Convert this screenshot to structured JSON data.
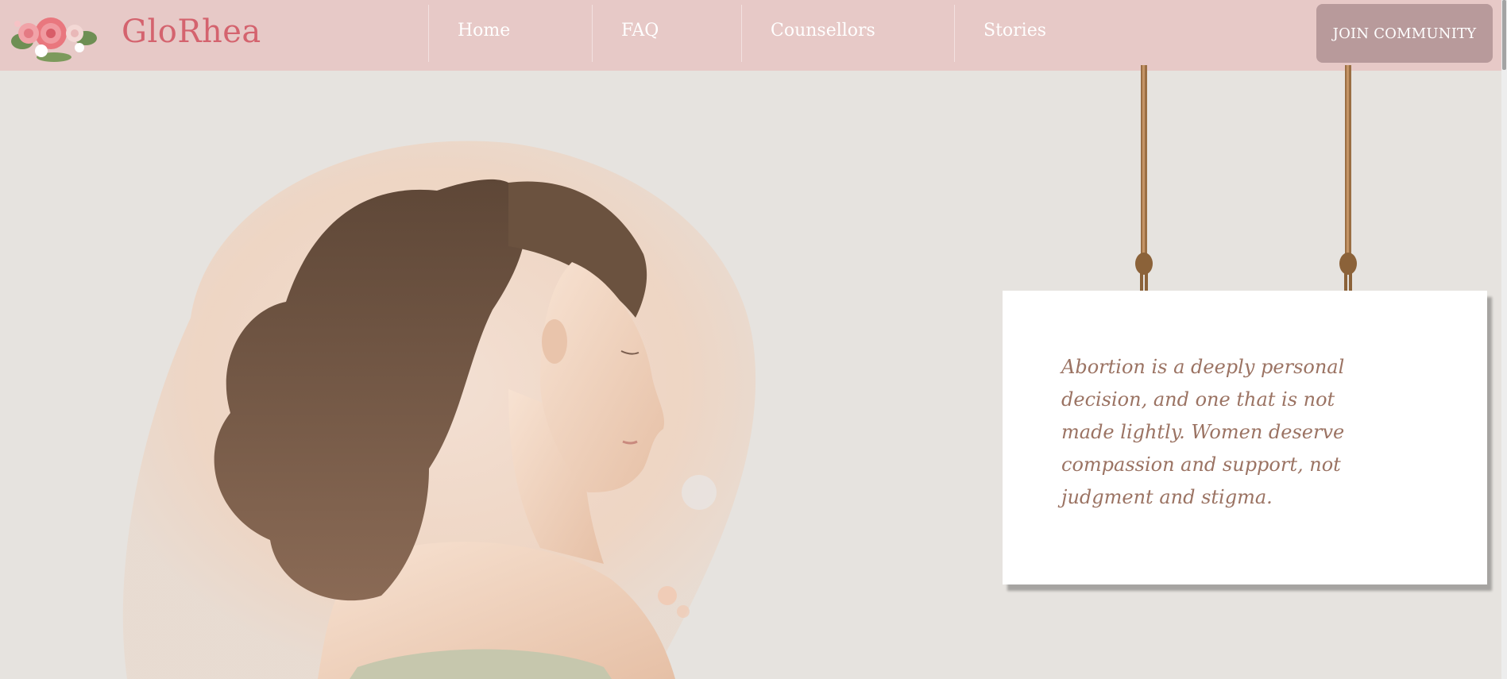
{
  "header": {
    "brand": "GloRhea",
    "nav": [
      {
        "label": "Home"
      },
      {
        "label": "FAQ"
      },
      {
        "label": "Counsellors"
      },
      {
        "label": "Stories"
      }
    ],
    "cta_label": "JOIN COMMUNITY"
  },
  "hero": {
    "quote": "Abortion is a deeply personal decision, and one that is not made lightly. Women deserve compassion and support, not judgment and stigma."
  },
  "icons": {
    "logo": "rose-bouquet-logo",
    "illustration": "woman-profile-illustration",
    "ropes": "hanging-rope"
  },
  "colors": {
    "navbar": "#e7c9c7",
    "brand": "#d4636e",
    "cta": "#b89a9b",
    "background": "#e6e3df",
    "quote_text": "#9b7363"
  }
}
